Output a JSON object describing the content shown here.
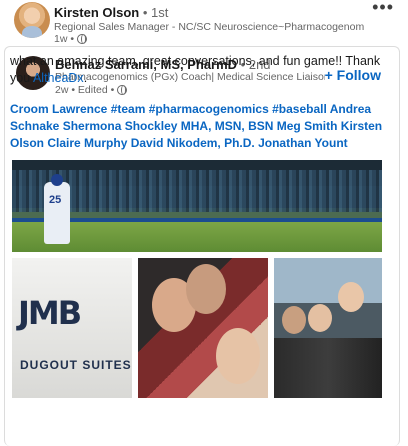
{
  "outer_post": {
    "name": "Kirsten Olson",
    "degree": " • 1st",
    "headline": "Regional Sales Manager - NC/SC Neuroscience~Pharmacogenomics (P...",
    "time": "1w •",
    "more_label": "•••"
  },
  "reshared_post": {
    "name": "Behnaz Sarrami, MS, PharmD",
    "degree": " • 2nd",
    "headline": "Pharmacogenomics (PGx) Coach| Medical Science Liaison|...",
    "time": "2w • Edited •",
    "follow_label": "+ Follow",
    "text_main": "what an amazing team, great conversations, and fun game!! Thank you",
    "text_link": "AltheaDx",
    "text_end": ".",
    "tags": [
      "Croom Lawrence",
      "#team",
      "#pharmacogenomics",
      "#baseball",
      "Andrea Schnake",
      "Shermona Shockley MHA, MSN, BSN",
      "Meg Smith",
      "Kirsten Olson",
      "Claire Murphy",
      "David Nikodem, Ph.D.",
      "Jonathan Yount"
    ],
    "photo_texts": {
      "jersey_number": "25",
      "sign_logo": "JMB",
      "sign_text": "DUGOUT SUITES"
    }
  },
  "colors": {
    "link": "#0a66c2",
    "muted": "#666666",
    "text": "#191919"
  }
}
